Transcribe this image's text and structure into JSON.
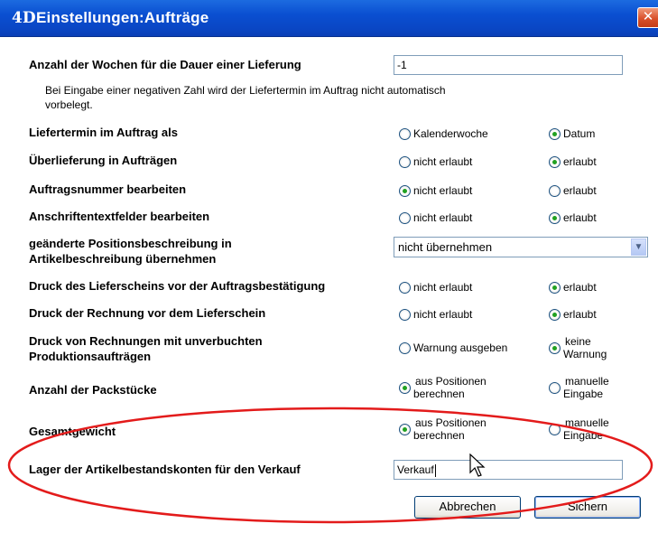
{
  "window": {
    "logo": "4D",
    "title": "Einstellungen:Aufträge",
    "close_icon": "close-icon",
    "accent_color": "#0a46c4"
  },
  "fields": {
    "weeks": {
      "label": "Anzahl der Wochen für die Dauer einer Lieferung",
      "value": "-1",
      "note": "Bei Eingabe einer negativen Zahl wird der Liefertermin im Auftrag nicht automatisch vorbelegt."
    },
    "delivery_date": {
      "label": "Liefertermin im Auftrag als",
      "opt1": "Kalenderwoche",
      "opt2": "Datum",
      "selected": "Datum"
    },
    "over_delivery": {
      "label": "Überlieferung in Aufträgen",
      "opt1": "nicht erlaubt",
      "opt2": "erlaubt",
      "selected": "erlaubt"
    },
    "order_number": {
      "label": "Auftragsnummer bearbeiten",
      "opt1": "nicht erlaubt",
      "opt2": "erlaubt",
      "selected": "nicht erlaubt"
    },
    "address_fields": {
      "label": "Anschriftentextfelder bearbeiten",
      "opt1": "nicht erlaubt",
      "opt2": "erlaubt",
      "selected": "erlaubt"
    },
    "position_desc": {
      "label_line1": "geänderte Positionsbeschreibung in",
      "label_line2": "Artikelbeschreibung übernehmen",
      "value": "nicht übernehmen"
    },
    "print_delivery_note": {
      "label": "Druck des Lieferscheins vor der Auftragsbestätigung",
      "opt1": "nicht erlaubt",
      "opt2": "erlaubt",
      "selected": "erlaubt"
    },
    "print_invoice": {
      "label": "Druck der Rechnung vor dem Lieferschein",
      "opt1": "nicht erlaubt",
      "opt2": "erlaubt",
      "selected": "erlaubt"
    },
    "print_unbooked": {
      "label_line1": "Druck von Rechnungen mit unverbuchten",
      "label_line2": "Produktionsaufträgen",
      "opt1": "Warnung ausgeben",
      "opt2_line1": "keine",
      "opt2_line2": "Warnung",
      "selected": "keine Warnung"
    },
    "packages": {
      "label": "Anzahl der Packstücke",
      "opt1_line1": "aus Positionen",
      "opt1_line2": "berechnen",
      "opt2_line1": "manuelle",
      "opt2_line2": "Eingabe",
      "selected": "aus Positionen berechnen"
    },
    "total_weight": {
      "label": "Gesamtgewicht",
      "opt1_line1": "aus Positionen",
      "opt1_line2": "berechnen",
      "opt2_line1": "manuelle",
      "opt2_line2": "Eingabe",
      "selected": "aus Positionen berechnen"
    },
    "warehouse": {
      "label": "Lager der Artikelbestandskonten für den Verkauf",
      "value": "Verkauf"
    }
  },
  "buttons": {
    "cancel": "Abbrechen",
    "save": "Sichern"
  },
  "annotation": {
    "color": "#e31b1b",
    "icon": "mouse-cursor-icon"
  }
}
